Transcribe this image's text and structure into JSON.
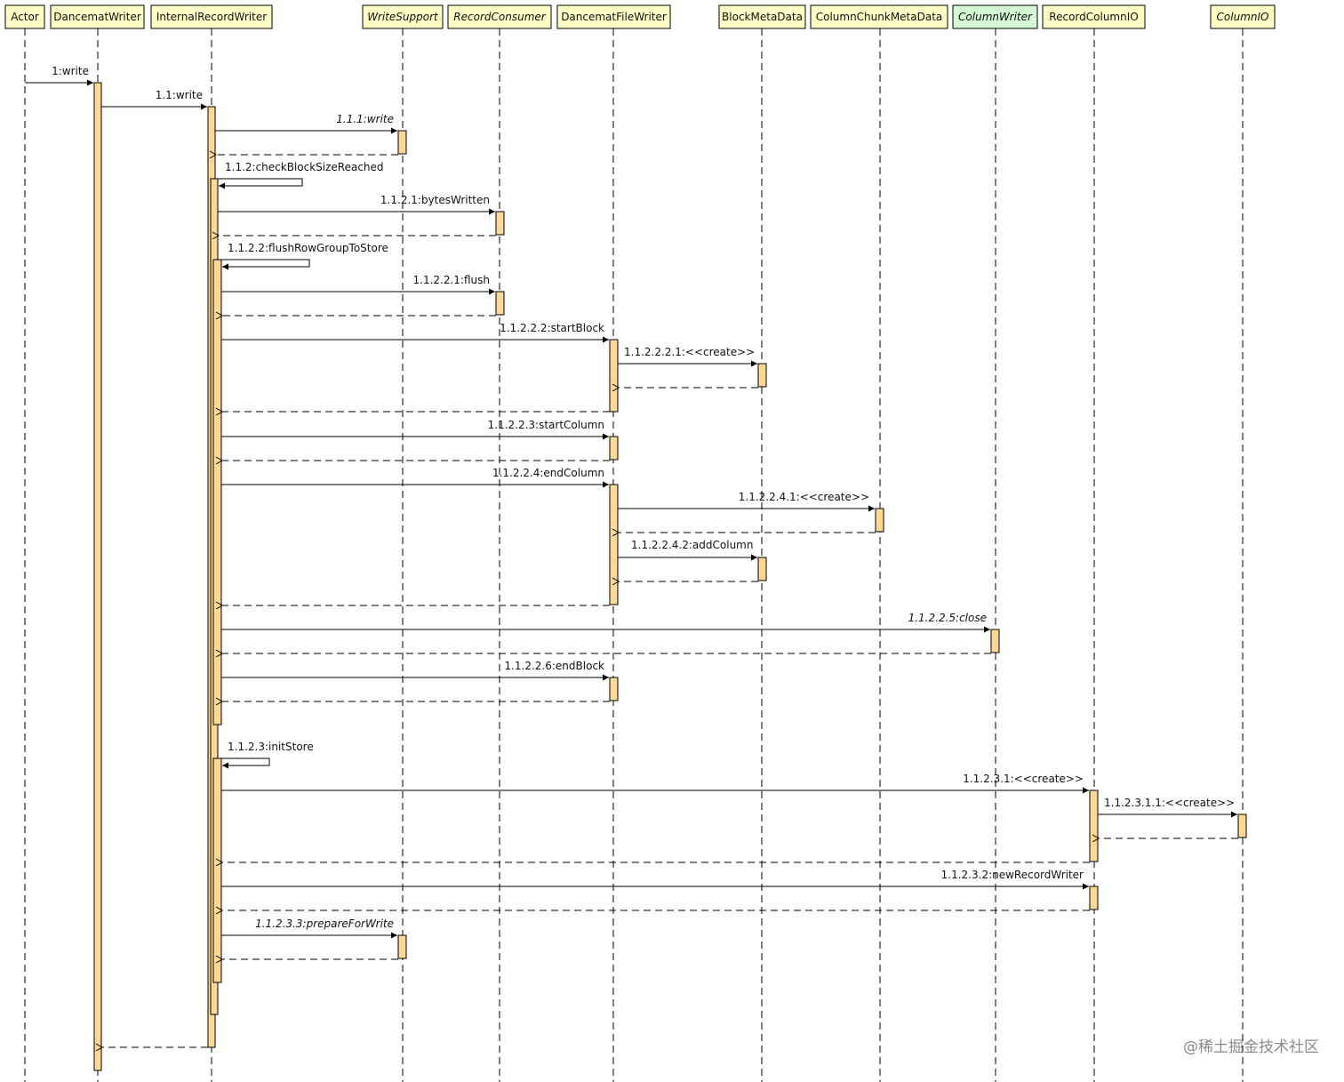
{
  "colors": {
    "header_fill": "#fdfdc4",
    "header_fill_highlight": "#d2f7d2",
    "activation_fill": "#fbd895",
    "line": "#000000"
  },
  "participants": [
    {
      "id": "actor",
      "label": "Actor",
      "italic": false,
      "highlight": false
    },
    {
      "id": "dancematwriter",
      "label": "DancematWriter",
      "italic": false,
      "highlight": false
    },
    {
      "id": "internalrecordwriter",
      "label": "InternalRecordWriter",
      "italic": false,
      "highlight": false
    },
    {
      "id": "writesupport",
      "label": "WriteSupport",
      "italic": true,
      "highlight": false
    },
    {
      "id": "recordconsumer",
      "label": "RecordConsumer",
      "italic": true,
      "highlight": false
    },
    {
      "id": "dancematfilewriter",
      "label": "DancematFileWriter",
      "italic": false,
      "highlight": false
    },
    {
      "id": "blockmetadata",
      "label": "BlockMetaData",
      "italic": false,
      "highlight": false
    },
    {
      "id": "columnchunkmetadata",
      "label": "ColumnChunkMetaData",
      "italic": false,
      "highlight": false
    },
    {
      "id": "columnwriter",
      "label": "ColumnWriter",
      "italic": true,
      "highlight": true
    },
    {
      "id": "recordcolumnio",
      "label": "RecordColumnIO",
      "italic": false,
      "highlight": false
    },
    {
      "id": "columnio",
      "label": "ColumnIO",
      "italic": true,
      "highlight": false
    }
  ],
  "messages": [
    {
      "label": "1:write",
      "italic": false
    },
    {
      "label": "1.1:write",
      "italic": false
    },
    {
      "label": "1.1.1:write",
      "italic": true
    },
    {
      "label": "1.1.2:checkBlockSizeReached",
      "italic": false
    },
    {
      "label": "1.1.2.1:bytesWritten",
      "italic": false
    },
    {
      "label": "1.1.2.2:flushRowGroupToStore",
      "italic": false
    },
    {
      "label": "1.1.2.2.1:flush",
      "italic": false
    },
    {
      "label": "1.1.2.2.2:startBlock",
      "italic": false
    },
    {
      "label": "1.1.2.2.2.1:<<create>>",
      "italic": false
    },
    {
      "label": "1.1.2.2.3:startColumn",
      "italic": false
    },
    {
      "label": "1.1.2.2.4:endColumn",
      "italic": false
    },
    {
      "label": "1.1.2.2.4.1:<<create>>",
      "italic": false
    },
    {
      "label": "1.1.2.2.4.2:addColumn",
      "italic": false
    },
    {
      "label": "1.1.2.2.5:close",
      "italic": true
    },
    {
      "label": "1.1.2.2.6:endBlock",
      "italic": false
    },
    {
      "label": "1.1.2.3:initStore",
      "italic": false
    },
    {
      "label": "1.1.2.3.1:<<create>>",
      "italic": false
    },
    {
      "label": "1.1.2.3.1.1:<<create>>",
      "italic": false
    },
    {
      "label": "1.1.2.3.2:newRecordWriter",
      "italic": false
    },
    {
      "label": "1.1.2.3.3:prepareForWrite",
      "italic": true
    }
  ],
  "watermark": "@稀土掘金技术社区"
}
